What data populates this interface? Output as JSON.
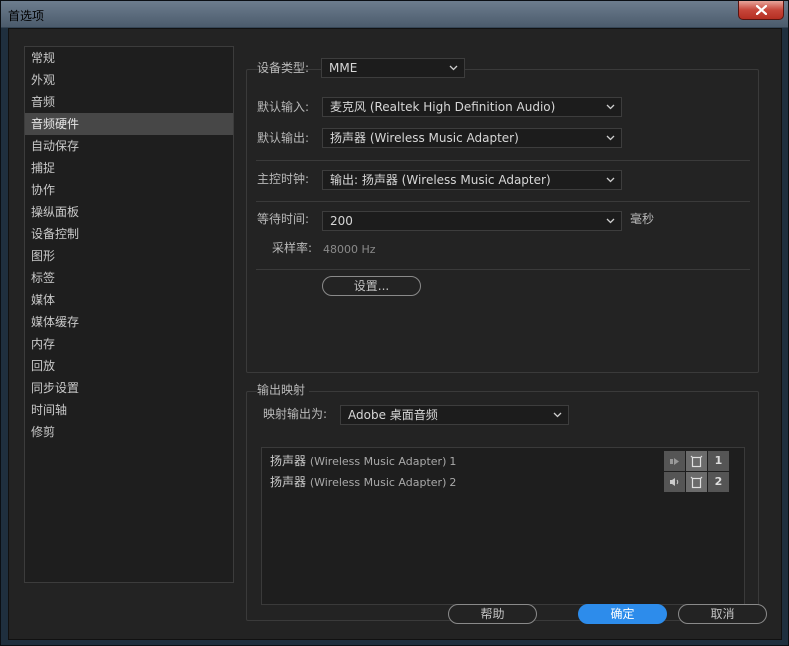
{
  "window": {
    "title": "首选项"
  },
  "sidebar": {
    "items": [
      {
        "label": "常规"
      },
      {
        "label": "外观"
      },
      {
        "label": "音频"
      },
      {
        "label": "音频硬件",
        "selected": true
      },
      {
        "label": "自动保存"
      },
      {
        "label": "捕捉"
      },
      {
        "label": "协作"
      },
      {
        "label": "操纵面板"
      },
      {
        "label": "设备控制"
      },
      {
        "label": "图形"
      },
      {
        "label": "标签"
      },
      {
        "label": "媒体"
      },
      {
        "label": "媒体缓存"
      },
      {
        "label": "内存"
      },
      {
        "label": "回放"
      },
      {
        "label": "同步设置"
      },
      {
        "label": "时间轴"
      },
      {
        "label": "修剪"
      }
    ]
  },
  "device": {
    "type_label": "设备类型:",
    "type_value": "MME",
    "default_input_label": "默认输入:",
    "default_input_value": "麦克风 (Realtek High Definition Audio)",
    "default_output_label": "默认输出:",
    "default_output_value": "扬声器 (Wireless Music Adapter)",
    "master_clock_label": "主控时钟:",
    "master_clock_value": "输出: 扬声器 (Wireless Music Adapter)",
    "latency_label": "等待时间:",
    "latency_value": "200",
    "latency_unit": "毫秒",
    "sample_rate_label": "采样率:",
    "sample_rate_value": "48000 Hz",
    "settings_button": "设置..."
  },
  "output_mapping": {
    "group_label": "输出映射",
    "map_to_label": "映射输出为:",
    "map_to_value": "Adobe 桌面音频",
    "rows": [
      {
        "prefix": "扬声器 ",
        "name": "(Wireless Music Adapter)",
        "channel": "1"
      },
      {
        "prefix": "扬声器 ",
        "name": "(Wireless Music Adapter)",
        "channel": "2"
      }
    ]
  },
  "footer": {
    "help": "帮助",
    "ok": "确定",
    "cancel": "取消"
  },
  "colors": {
    "accent": "#2d8ceb",
    "panel": "#232323",
    "selected_item": "#474747"
  }
}
